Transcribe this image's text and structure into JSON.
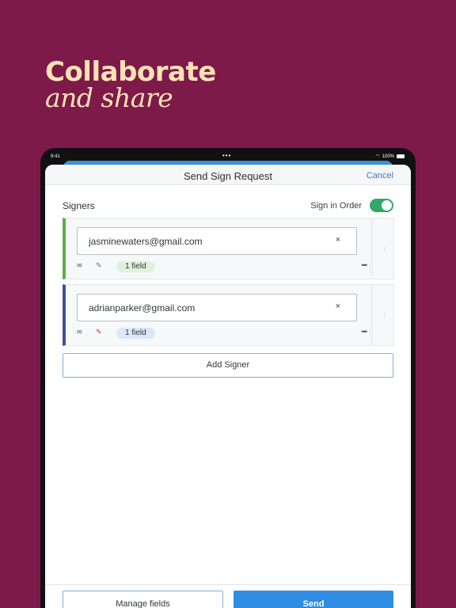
{
  "headline": {
    "line1": "Collaborate",
    "line2": "and share"
  },
  "status_bar": {
    "time": "9:41",
    "battery": "100%"
  },
  "nav": {
    "title": "Send Sign Request",
    "cancel_label": "Cancel"
  },
  "signers": {
    "label": "Signers",
    "sign_in_order_label": "Sign in Order",
    "sign_in_order_enabled": true,
    "items": [
      {
        "email": "jasminewaters@gmail.com",
        "fields_label": "1 field",
        "color": "#55b247"
      },
      {
        "email": "adrianparker@gmail.com",
        "fields_label": "1 field",
        "color": "#3d4ea8"
      }
    ],
    "add_signer_label": "Add Signer"
  },
  "footer": {
    "manage_fields_label": "Manage fields",
    "send_label": "Send"
  },
  "colors": {
    "background": "#7d1a4a",
    "headline": "#fbe3b4",
    "accent": "#2f8de4",
    "toggle": "#2fa86a"
  },
  "icons": [
    "wifi-icon",
    "battery-icon",
    "mail-icon",
    "pen-icon",
    "more-icon",
    "clear-icon",
    "drag-handle-icon"
  ]
}
